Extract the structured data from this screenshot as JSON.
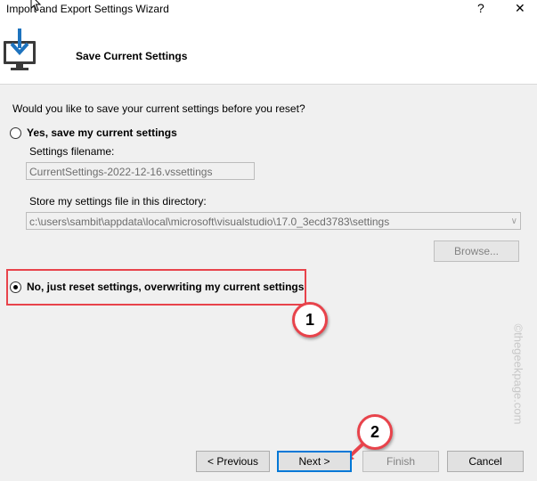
{
  "window": {
    "title": "Import and Export Settings Wizard",
    "help_glyph": "?",
    "close_glyph": "✕"
  },
  "header": {
    "title": "Save Current Settings",
    "icon": "monitor-download-icon"
  },
  "prompt": "Would you like to save your current settings before you reset?",
  "option_yes": {
    "label": "Yes, save my current settings",
    "selected": false
  },
  "filename": {
    "label": "Settings filename:",
    "value": "CurrentSettings-2022-12-16.vssettings"
  },
  "directory": {
    "label": "Store my settings file in this directory:",
    "value": "c:\\users\\sambit\\appdata\\local\\microsoft\\visualstudio\\17.0_3ecd3783\\settings",
    "arrow_glyph": "∨"
  },
  "browse_label": "Browse...",
  "option_no": {
    "label": "No, just reset settings, overwriting my current settings",
    "selected": true
  },
  "callouts": {
    "one": "1",
    "two": "2"
  },
  "watermark": "©thegeekpage.com",
  "buttons": {
    "previous": "< Previous",
    "next": "Next >",
    "finish": "Finish",
    "cancel": "Cancel"
  },
  "colors": {
    "annotation_red": "#e8434b",
    "focus_blue": "#0078d7",
    "icon_blue": "#1e73be"
  }
}
